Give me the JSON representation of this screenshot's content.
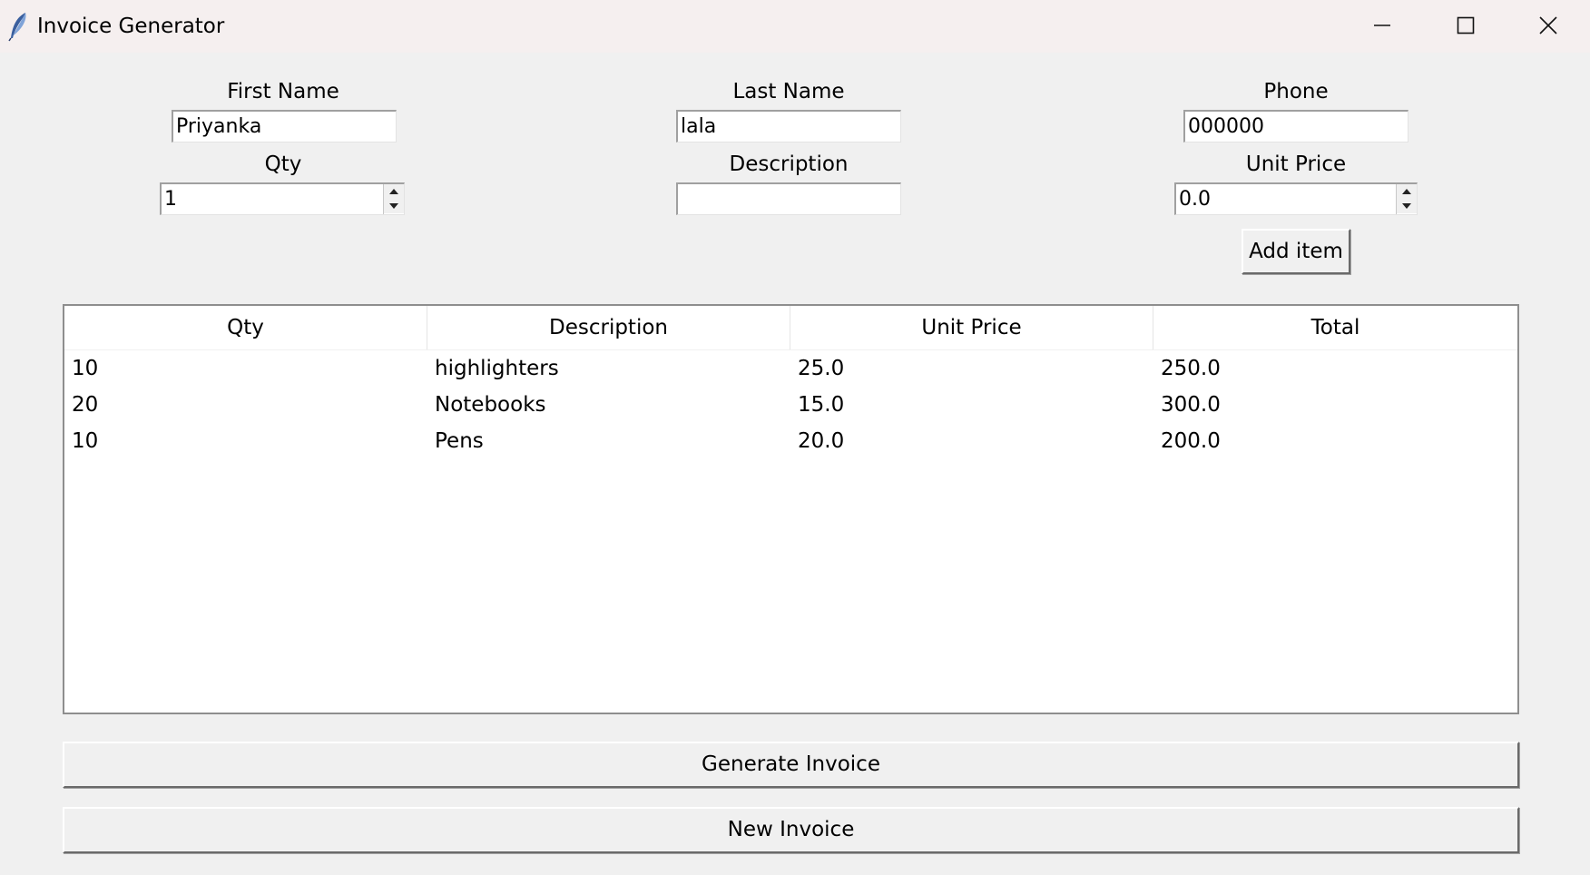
{
  "window": {
    "title": "Invoice Generator",
    "icons": {
      "app": "feather-icon",
      "minimize": "minimize-icon",
      "maximize": "maximize-icon",
      "close": "close-icon"
    }
  },
  "form": {
    "first_name": {
      "label": "First Name",
      "value": "Priyanka"
    },
    "last_name": {
      "label": "Last Name",
      "value": "lala"
    },
    "phone": {
      "label": "Phone",
      "value": "000000"
    },
    "qty": {
      "label": "Qty",
      "value": "1"
    },
    "description": {
      "label": "Description",
      "value": ""
    },
    "unit_price": {
      "label": "Unit Price",
      "value": "0.0"
    },
    "add_item_label": "Add item"
  },
  "table": {
    "columns": [
      "Qty",
      "Description",
      "Unit Price",
      "Total"
    ],
    "rows": [
      [
        "10",
        "highlighters",
        "25.0",
        "250.0"
      ],
      [
        "20",
        "Notebooks",
        "15.0",
        "300.0"
      ],
      [
        "10",
        "Pens",
        "20.0",
        "200.0"
      ]
    ]
  },
  "actions": {
    "generate_label": "Generate  Invoice",
    "new_label": "New Invoice"
  }
}
